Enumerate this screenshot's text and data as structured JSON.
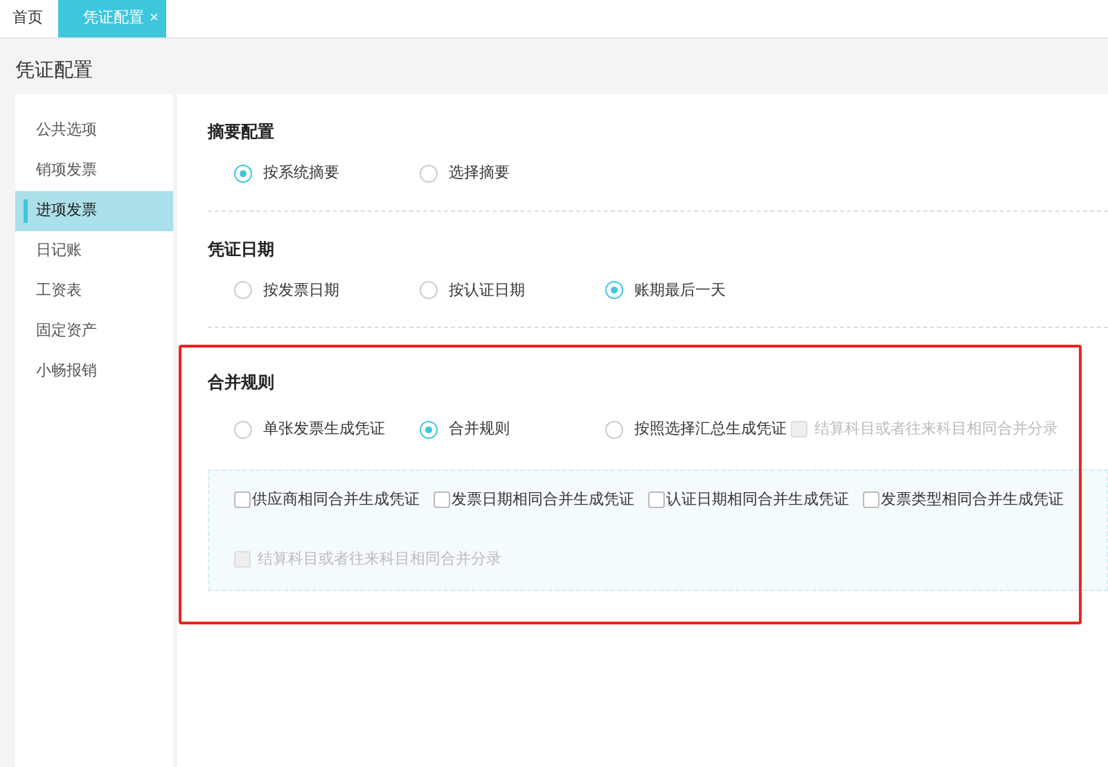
{
  "tabs": [
    {
      "label": "首页",
      "selected": false
    },
    {
      "label": "凭证配置",
      "selected": true,
      "close_glyph": "×"
    }
  ],
  "page_title": "凭证配置",
  "sidebar": {
    "items": [
      {
        "label": "公共选项",
        "selected": false
      },
      {
        "label": "销项发票",
        "selected": false
      },
      {
        "label": "进项发票",
        "selected": true
      },
      {
        "label": "日记账",
        "selected": false
      },
      {
        "label": "工资表",
        "selected": false
      },
      {
        "label": "固定资产",
        "selected": false
      },
      {
        "label": "小畅报销",
        "selected": false
      }
    ]
  },
  "sections": [
    {
      "title": "摘要配置",
      "divider": true,
      "options": [
        {
          "kind": "radio",
          "label": "按系统摘要",
          "selected": true,
          "disabled": false
        },
        {
          "kind": "radio",
          "label": "选择摘要",
          "selected": false,
          "disabled": false
        }
      ]
    },
    {
      "title": "凭证日期",
      "divider": true,
      "options": [
        {
          "kind": "radio",
          "label": "按发票日期",
          "selected": false,
          "disabled": false
        },
        {
          "kind": "radio",
          "label": "按认证日期",
          "selected": false,
          "disabled": false
        },
        {
          "kind": "radio",
          "label": "账期最后一天",
          "selected": true,
          "disabled": false
        }
      ]
    },
    {
      "title": "合并规则",
      "highlighted": true,
      "options": [
        {
          "kind": "radio",
          "label": "单张发票生成凭证",
          "selected": false,
          "disabled": false
        },
        {
          "kind": "radio",
          "label": "合并规则",
          "selected": true,
          "disabled": false
        },
        {
          "kind": "radio",
          "label": "按照选择汇总生成凭证",
          "selected": false,
          "disabled": false
        },
        {
          "kind": "checkbox",
          "label": "结算科目或者往来科目相同合并分录",
          "checked": false,
          "disabled": true
        }
      ],
      "sub_options": [
        [
          {
            "label": "供应商相同合并生成凭证",
            "checked": false,
            "disabled": false
          },
          {
            "label": "发票日期相同合并生成凭证",
            "checked": false,
            "disabled": false
          },
          {
            "label": "认证日期相同合并生成凭证",
            "checked": false,
            "disabled": false
          },
          {
            "label": "发票类型相同合并生成凭证",
            "checked": false,
            "disabled": false
          }
        ],
        [
          {
            "label": "结算科目或者往来科目相同合并分录",
            "checked": false,
            "disabled": true
          }
        ]
      ]
    }
  ]
}
